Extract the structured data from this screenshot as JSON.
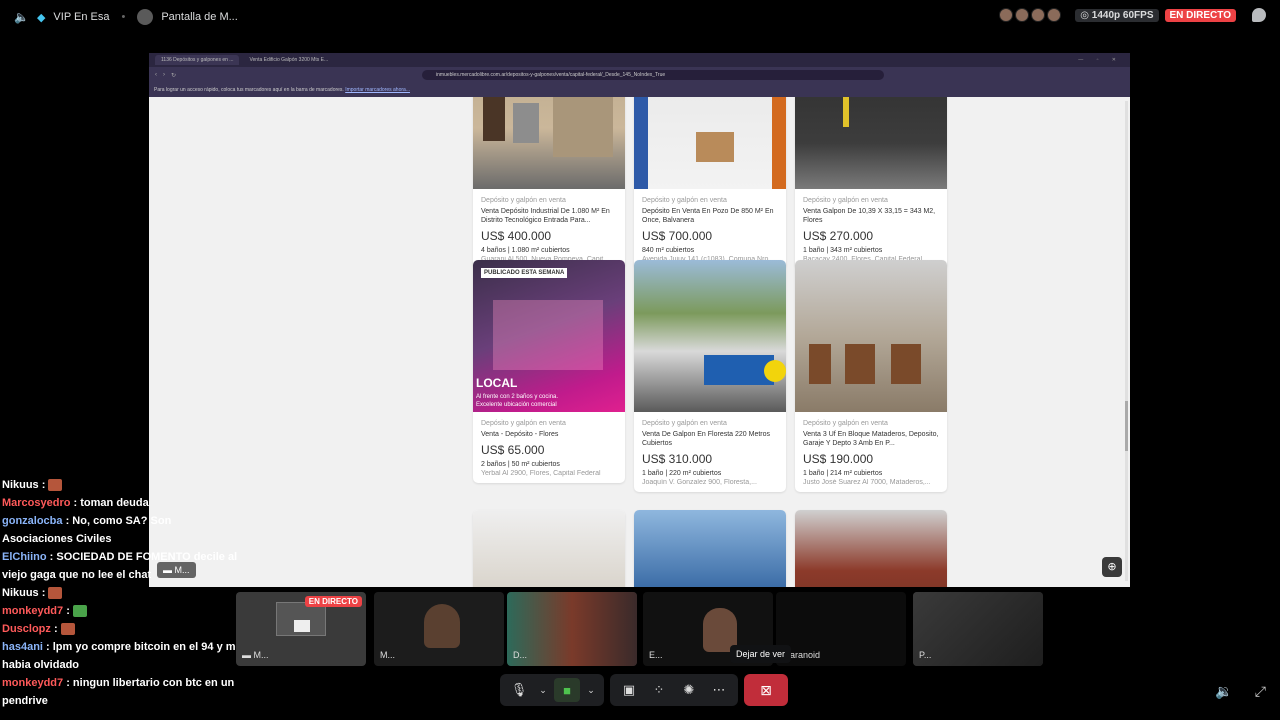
{
  "topbar": {
    "channel": "VIP En Esa",
    "stream_title": "Pantalla de M...",
    "quality": "1440p 60FPS",
    "live": "EN DIRECTO"
  },
  "browser": {
    "tab1": "1136 Depósitos y galpones en ...",
    "tab2": "Venta Edificio Galpón 3200 Mts E...",
    "url": "inmuebles.mercadolibre.com.ar/depositos-y-galpones/venta/capital-federal/_Desde_145_NoIndex_True",
    "bookmarks_text": "Para lograr un acceso rápido, coloca tus marcadores aquí en la barra de marcadores.",
    "bookmarks_link": "Importar marcadores ahora..."
  },
  "listings": [
    {
      "cat": "Depósito y galpón en venta",
      "title": "Venta Depósito Industrial De 1.080 M² En Distrito Tecnológico Entrada Para...",
      "price": "US$ 400.000",
      "specs": "4 baños | 1.080 m² cubiertos",
      "addr": "Guarani Al 500, Nueva Pompeya, Capit..."
    },
    {
      "cat": "Depósito y galpón en venta",
      "title": "Depósito En Venta En Pozo De 850 M² En Once, Balvanera",
      "price": "US$ 700.000",
      "specs": "840 m² cubiertos",
      "addr": "Avenida Jujuy 141 (c1083), Comuna Nro..."
    },
    {
      "cat": "Depósito y galpón en venta",
      "title": "Venta Galpon De 10,39 X 33,15 = 343 M2, Flores",
      "price": "US$ 270.000",
      "specs": "1 baño | 343 m² cubiertos",
      "addr": "Bacacay 2400, Flores, Capital Federal"
    },
    {
      "cat": "Depósito y galpón en venta",
      "title": "Venta - Depósito - Flores",
      "price": "US$ 65.000",
      "specs": "2 baños | 50 m² cubiertos",
      "addr": "Yerbal Al 2900, Flores, Capital Federal",
      "badge": "PUBLICADO ESTA SEMANA",
      "overlay_big": "LOCAL",
      "overlay_small1": "Al frente con 2 baños y cocina.",
      "overlay_small2": "Excelente ubicación comercial"
    },
    {
      "cat": "Depósito y galpón en venta",
      "title": "Venta De Galpon En Floresta 220 Metros Cubiertos",
      "price": "US$ 310.000",
      "specs": "1 baño | 220 m² cubiertos",
      "addr": "Joaquín V. Gonzalez 900, Floresta,..."
    },
    {
      "cat": "Depósito y galpón en venta",
      "title": "Venta 3 Uf En Bloque Mataderos, Deposito, Garaje Y Depto 3 Amb En P...",
      "price": "US$ 190.000",
      "specs": "1 baño | 214 m² cubiertos",
      "addr": "Justo José Suarez Al 7000, Mataderos,..."
    }
  ],
  "share_label": "M...",
  "chat": [
    {
      "user": "Nikuus",
      "text": "",
      "color": "white"
    },
    {
      "user": "Marcosyedro",
      "text": "toman deuda",
      "color": "red"
    },
    {
      "user": "gonzalocba",
      "text": "No, como SA? Son Asociaciones Civiles",
      "color": "blue"
    },
    {
      "user": "ElChiino",
      "text": "SOCIEDAD DE FOMENTO decile al viejo gaga que no lee el chat",
      "color": "blue"
    },
    {
      "user": "Nikuus",
      "text": "",
      "color": "white"
    },
    {
      "user": "monkeydd7",
      "text": "",
      "color": "red"
    },
    {
      "user": "Dusclopz",
      "text": "",
      "color": "red"
    },
    {
      "user": "has4ani",
      "text": "lpm yo compre bitcoin en el 94 y me habia olvidado",
      "color": "blue"
    },
    {
      "user": "monkeydd7",
      "text": "ningun libertario con btc en un pendrive",
      "color": "red"
    }
  ],
  "tiles": [
    {
      "name": "M...",
      "live": "EN DIRECTO"
    },
    {
      "name": "M..."
    },
    {
      "name": "D..."
    },
    {
      "name": "E..."
    },
    {
      "name": "aranoid"
    },
    {
      "name": "P..."
    }
  ],
  "tooltip": "Dejar de ver"
}
